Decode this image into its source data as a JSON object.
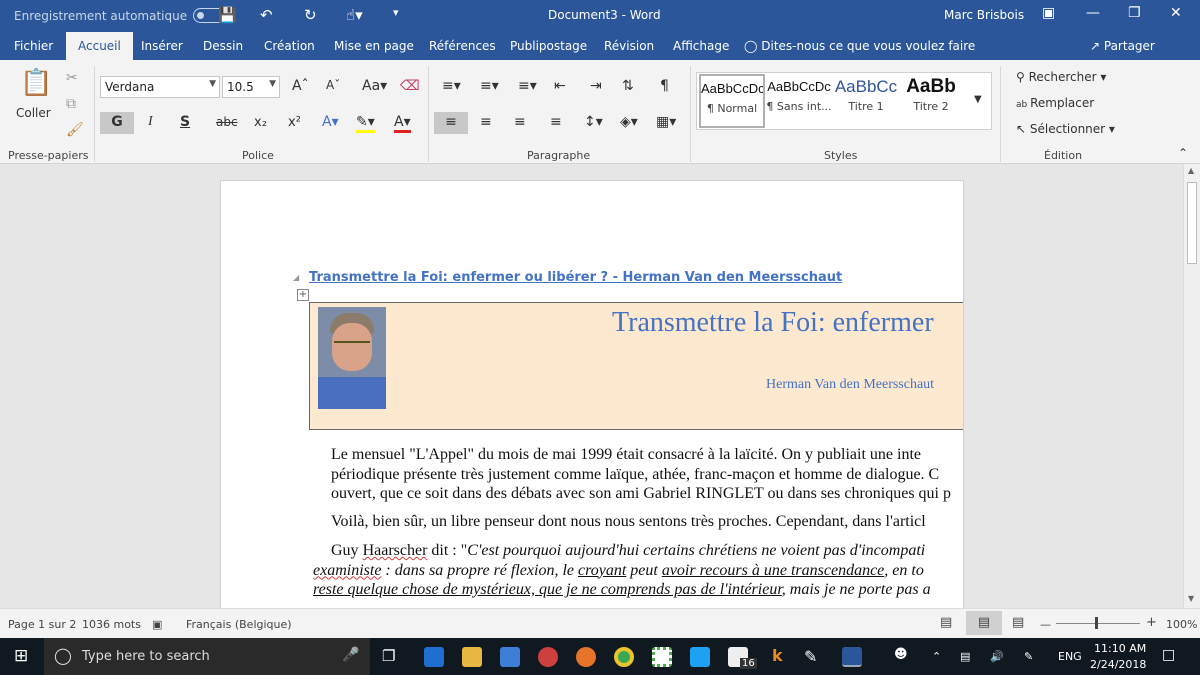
{
  "titlebar": {
    "autosave_label": "Enregistrement automatique",
    "document_title": "Document3 - Word",
    "user": "Marc Brisbois"
  },
  "tabs": [
    {
      "label": "Fichier"
    },
    {
      "label": "Accueil"
    },
    {
      "label": "Insérer"
    },
    {
      "label": "Dessin"
    },
    {
      "label": "Création"
    },
    {
      "label": "Mise en page"
    },
    {
      "label": "Références"
    },
    {
      "label": "Publipostage"
    },
    {
      "label": "Révision"
    },
    {
      "label": "Affichage"
    }
  ],
  "tellme": "Dites-nous ce que vous voulez faire",
  "share": "Partager",
  "ribbon": {
    "paste_label": "Coller",
    "font_name": "Verdana",
    "font_size": "10.5",
    "bold": "G",
    "italic": "I",
    "underline": "S",
    "strike": "abc",
    "subscript": "x₂",
    "superscript": "x²",
    "styles": [
      {
        "preview": "AaBbCcDc",
        "name": "¶ Normal"
      },
      {
        "preview": "AaBbCcDc",
        "name": "¶ Sans int..."
      },
      {
        "preview": "AaBbCc",
        "name": "Titre 1"
      },
      {
        "preview": "AaBb",
        "name": "Titre 2"
      }
    ],
    "find": "Rechercher",
    "replace": "Remplacer",
    "select": "Sélectionner",
    "groups": {
      "clipboard": "Presse-papiers",
      "font": "Police",
      "paragraph": "Paragraphe",
      "styles": "Styles",
      "editing": "Édition"
    }
  },
  "document": {
    "heading": "Transmettre la Foi: enfermer ou libérer ? - Herman Van den Meersschaut",
    "banner_title": "Transmettre la Foi: enfermer",
    "banner_author": "Herman Van den Meersschaut",
    "p1_l1": "Le mensuel \"L'Appel\" du mois de mai 1999 était consacré à la laïcité. On y publiait une inte",
    "p1_l2": "périodique présente très justement comme laïque, athée, franc-maçon et homme de dialogue. C",
    "p1_l3": "ouvert, que ce soit dans des débats avec son ami Gabriel RINGLET ou dans ses chroniques qui p",
    "p2": "Voilà, bien sûr, un libre penseur dont nous nous sentons très proches. Cependant, dans l'articl",
    "p3_start": "Guy ",
    "p3_name": "Haarscher",
    "p3_mid": " dit : \"",
    "p3_italic": "C'est pourquoi aujourd'hui certains chrétiens ne voient pas d'incompati",
    "p3_l2a": "exaministe",
    "p3_l2b": " : dans sa propre ré flexion, le ",
    "p3_l2c": "croyant",
    "p3_l2d": " peut ",
    "p3_l2e": "avoir recours à une transcendance",
    "p3_l2f": ", en to",
    "p3_l3a": "reste quelque chose de mystérieux, que je ne comprends pas de l'intérieur",
    "p3_l3b": ", mais je ne porte pas a"
  },
  "status": {
    "page": "Page 1 sur 2",
    "words": "1036 mots",
    "language": "Français (Belgique)",
    "zoom": "100%"
  },
  "taskbar": {
    "search_placeholder": "Type here to search",
    "lang": "ENG",
    "time": "11:10 AM",
    "date": "2/24/2018",
    "mail_badge": "16"
  }
}
